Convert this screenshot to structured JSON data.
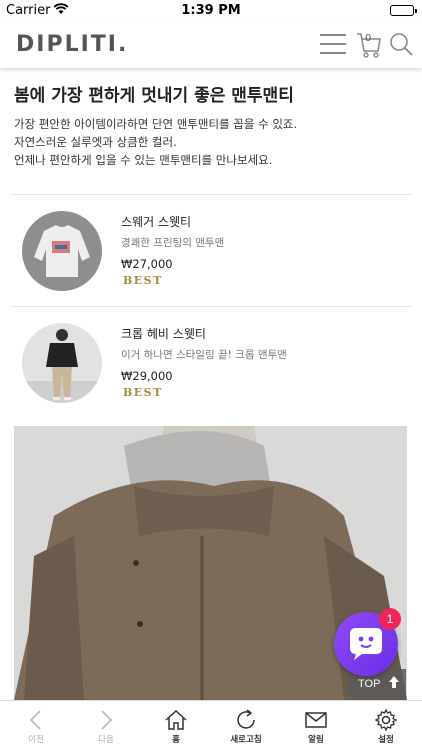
{
  "status_bar": {
    "carrier": "Carrier",
    "time": "1:39 PM"
  },
  "header": {
    "logo": "DIPLITI.",
    "cart_count": "0"
  },
  "page": {
    "title": "봄에 가장 편하게 멋내기 좋은 맨투맨티",
    "description": [
      "가장 편안한 아이템이라하면 단연 맨투맨티를 꼽을 수 있죠.",
      "자연스러운 실루엣과 상큼한 컬러.",
      "언제나 편안하게 입을 수 있는 맨투맨티를 만나보세요."
    ]
  },
  "products": [
    {
      "name": "스웨거 스웻티",
      "subtitle": "경쾌한 프린팅의 맨투맨",
      "price": "₩27,000",
      "badge": "BEST"
    },
    {
      "name": "크롭 헤비 스웻티",
      "subtitle": "이거 하나면 스타일링 끝! 크롭 맨투맨",
      "price": "₩29,000",
      "badge": "BEST"
    }
  ],
  "chat": {
    "notification_count": "1"
  },
  "top_button": {
    "label": "TOP"
  },
  "bottom_nav": [
    {
      "label": "이전",
      "icon": "chevron-left-icon"
    },
    {
      "label": "다음",
      "icon": "chevron-right-icon"
    },
    {
      "label": "홈",
      "icon": "home-icon"
    },
    {
      "label": "새로고침",
      "icon": "refresh-icon"
    },
    {
      "label": "알림",
      "icon": "mail-icon"
    },
    {
      "label": "설정",
      "icon": "gear-icon"
    }
  ],
  "colors": {
    "accent_gold": "#a58b3d",
    "chat_purple": "#7b3cf0",
    "badge_red": "#f0245b"
  }
}
